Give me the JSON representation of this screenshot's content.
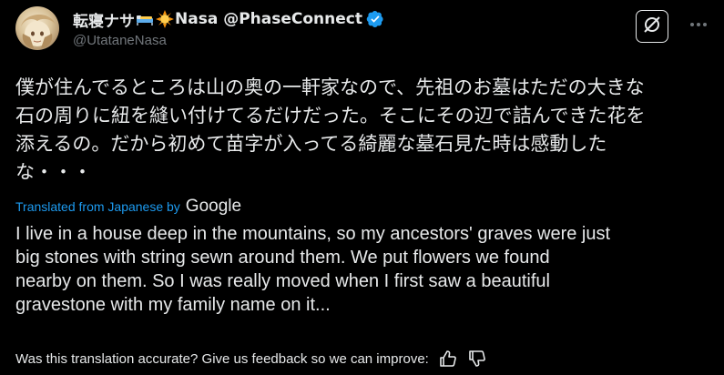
{
  "author": {
    "display_name_jp": "転寝ナサ",
    "display_name_en": "Nasa @PhaseConnect",
    "handle": "@UtataneNasa",
    "emojis": [
      "bed-emoji",
      "sun-emoji"
    ],
    "verified_color": "#1d9bf0"
  },
  "post": {
    "jp_lines": [
      "僕が住んでるところは山の奥の一軒家なので、先祖のお墓はただの大きな",
      "石の周りに紐を縫い付けてるだけだった。そこにその辺で詰んできた花を",
      "添えるの。だから初めて苗字が入ってる綺麗な墓石見た時は感動した",
      "な・・・"
    ],
    "translated_label": "Translated from Japanese by",
    "translator": "Google",
    "en_lines": [
      "I live in a house deep in the mountains, so my ancestors' graves were just",
      "big stones with string sewn around them. We put flowers we found",
      "nearby on them. So I was really moved when I first saw a beautiful",
      "gravestone with my family name on it..."
    ]
  },
  "feedback": {
    "question": "Was this translation accurate? Give us feedback so we can improve:",
    "icons": [
      "thumbs-up-icon",
      "thumbs-down-icon"
    ]
  },
  "header_icons": [
    "grok-icon",
    "more-options-icon"
  ],
  "colors": {
    "background": "#000000",
    "text": "#e7e9ea",
    "secondary": "#71767b",
    "accent": "#1d9bf0"
  }
}
